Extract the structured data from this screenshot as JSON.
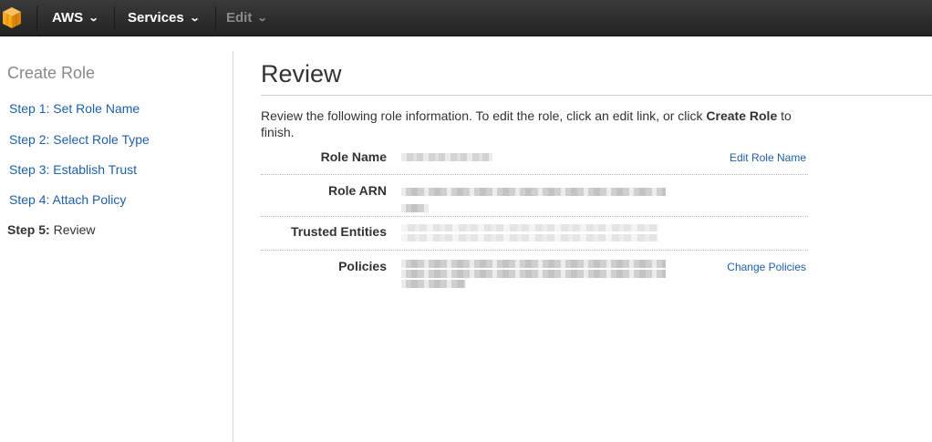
{
  "nav": {
    "brand": "AWS",
    "services": "Services",
    "edit": "Edit",
    "caret": "⌄"
  },
  "sidebar": {
    "title": "Create Role",
    "steps": [
      {
        "label": "Step 1: Set Role Name"
      },
      {
        "label": "Step 2: Select Role Type"
      },
      {
        "label": "Step 3: Establish Trust"
      },
      {
        "label": "Step 4: Attach Policy"
      },
      {
        "prefix": "Step 5:",
        "label": " Review"
      }
    ]
  },
  "main": {
    "title": "Review",
    "intro_before": "Review the following role information. To edit the role, click an edit link, or click ",
    "intro_bold": "Create Role",
    "intro_after": " to finish.",
    "rows": [
      {
        "label": "Role Name",
        "link": "Edit Role Name"
      },
      {
        "label": "Role ARN",
        "link": ""
      },
      {
        "label": "Trusted Entities",
        "link": ""
      },
      {
        "label": "Policies",
        "link": "Change Policies"
      }
    ]
  },
  "colors": {
    "link": "#1f5fa6",
    "topbar": "#232323",
    "logo_orange": "#f7a81b"
  },
  "icons": {
    "logo": "aws-cube-icon",
    "caret": "chevron-down-icon"
  }
}
